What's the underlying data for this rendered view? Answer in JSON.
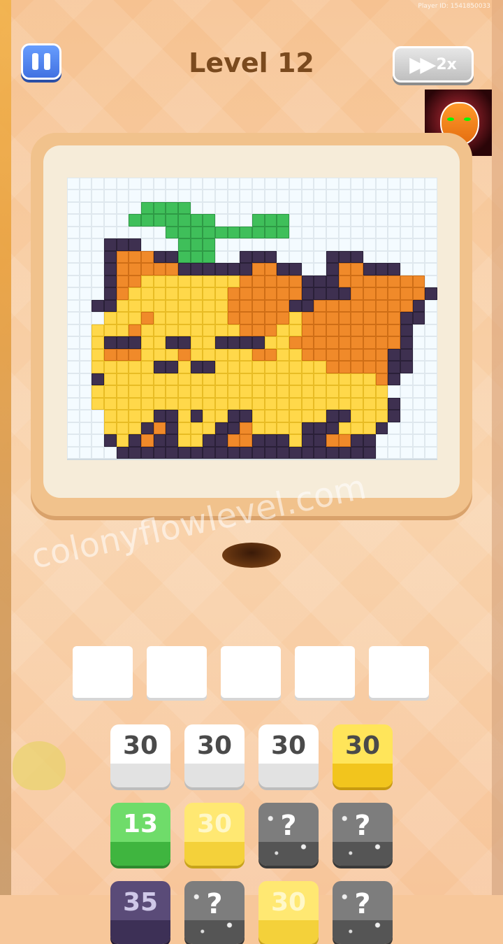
{
  "header": {
    "player_id": "Player ID: 1541850033",
    "level_title": "Level 12",
    "speed_label": "2x"
  },
  "watermark": "colonyflowlevel.com",
  "icons": {
    "pause": "pause-icon",
    "speed": "fast-forward-icon",
    "logo": "tiger-logo"
  },
  "colors": {
    "green": "#3fbf5a",
    "orange": "#f08a2a",
    "yellow": "#ffd84a",
    "dark": "#3e3050"
  },
  "slots": {
    "count": 5
  },
  "tiles": [
    {
      "row": 0,
      "col": 0,
      "value": "30",
      "color": "white"
    },
    {
      "row": 0,
      "col": 1,
      "value": "30",
      "color": "white"
    },
    {
      "row": 0,
      "col": 2,
      "value": "30",
      "color": "white"
    },
    {
      "row": 0,
      "col": 3,
      "value": "30",
      "color": "yellow"
    },
    {
      "row": 1,
      "col": 0,
      "value": "13",
      "color": "green"
    },
    {
      "row": 1,
      "col": 1,
      "value": "30",
      "color": "yellow-soft"
    },
    {
      "row": 1,
      "col": 2,
      "value": "?",
      "color": "mystery"
    },
    {
      "row": 1,
      "col": 3,
      "value": "?",
      "color": "mystery"
    },
    {
      "row": 2,
      "col": 0,
      "value": "35",
      "color": "dark"
    },
    {
      "row": 2,
      "col": 1,
      "value": "?",
      "color": "mystery"
    },
    {
      "row": 2,
      "col": 2,
      "value": "30",
      "color": "yellow-soft"
    },
    {
      "row": 2,
      "col": 3,
      "value": "?",
      "color": "mystery"
    }
  ]
}
